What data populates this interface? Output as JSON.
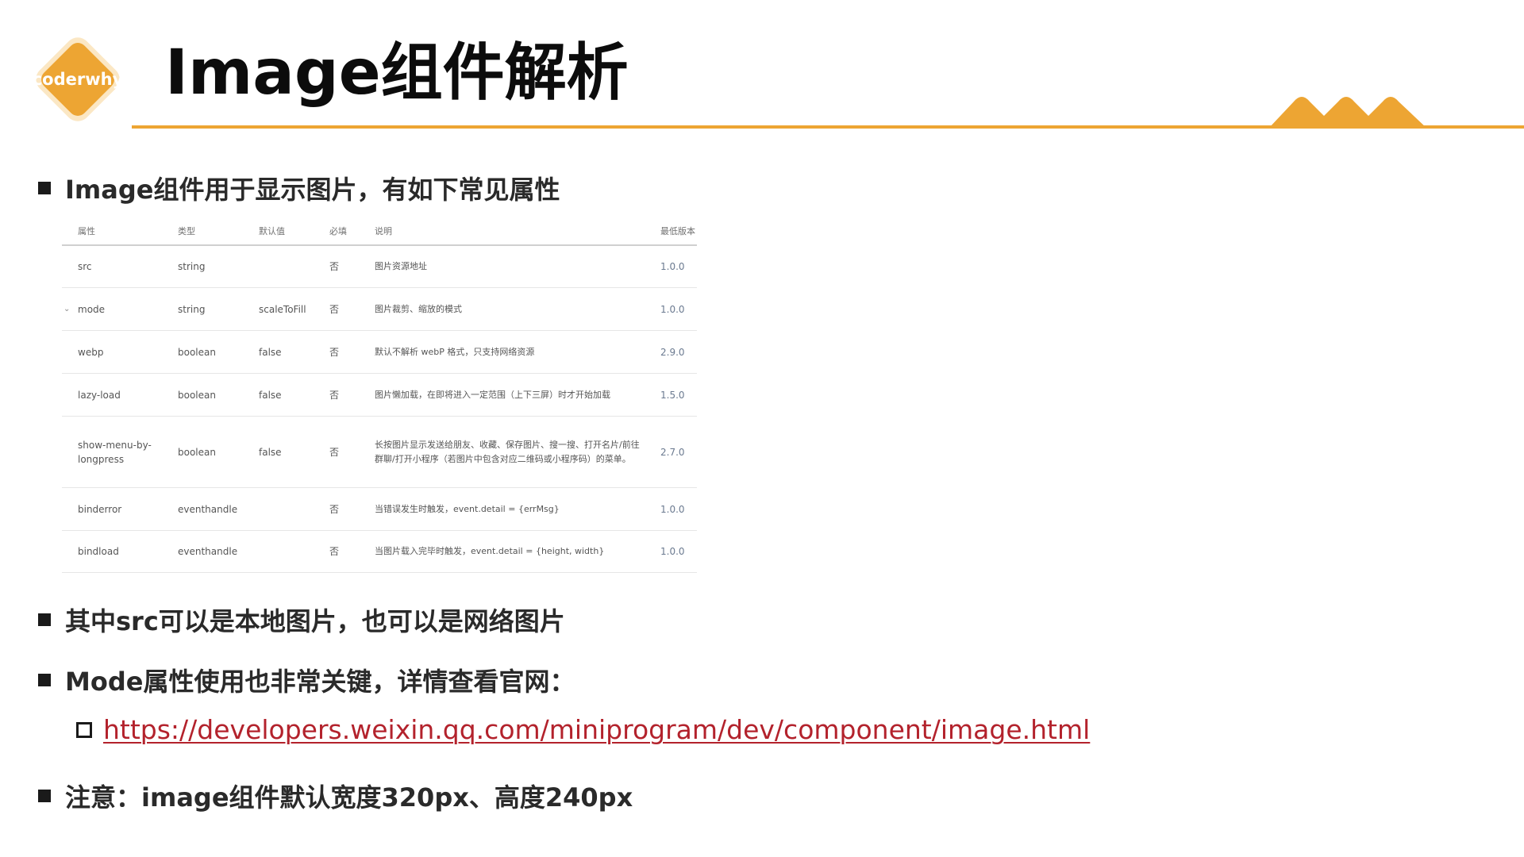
{
  "logo": {
    "text": "coderwhy",
    "color": "#eda533",
    "icon": "diamond-logo-icon"
  },
  "header": {
    "title": "Image组件解析",
    "accent_color": "#eda533",
    "decoration_icon": "mountains-icon"
  },
  "bullets": {
    "b1": "Image组件用于显示图片，有如下常见属性",
    "b2": "其中src可以是本地图片，也可以是网络图片",
    "b3": "Mode属性使用也非常关键，详情查看官网：",
    "b3_link": "https://developers.weixin.qq.com/miniprogram/dev/component/image.html",
    "b4": "注意：image组件默认宽度320px、高度240px"
  },
  "table": {
    "headers": {
      "attr": "属性",
      "type": "类型",
      "default": "默认值",
      "required": "必填",
      "desc": "说明",
      "version": "最低版本"
    },
    "rows": [
      {
        "attr": "src",
        "type": "string",
        "default": "",
        "required": "否",
        "desc": "图片资源地址",
        "version": "1.0.0"
      },
      {
        "attr": "mode",
        "type": "string",
        "default": "scaleToFill",
        "required": "否",
        "desc": "图片裁剪、缩放的模式",
        "version": "1.0.0",
        "expandable": true
      },
      {
        "attr": "webp",
        "type": "boolean",
        "default": "false",
        "required": "否",
        "desc": "默认不解析 webP 格式，只支持网络资源",
        "version": "2.9.0"
      },
      {
        "attr": "lazy-load",
        "type": "boolean",
        "default": "false",
        "required": "否",
        "desc": "图片懒加载，在即将进入一定范围（上下三屏）时才开始加载",
        "version": "1.5.0"
      },
      {
        "attr": "show-menu-by-longpress",
        "type": "boolean",
        "default": "false",
        "required": "否",
        "desc": "长按图片显示发送给朋友、收藏、保存图片、搜一搜、打开名片/前往群聊/打开小程序（若图片中包含对应二维码或小程序码）的菜单。",
        "version": "2.7.0"
      },
      {
        "attr": "binderror",
        "type": "eventhandle",
        "default": "",
        "required": "否",
        "desc": "当错误发生时触发，event.detail = {errMsg}",
        "version": "1.0.0"
      },
      {
        "attr": "bindload",
        "type": "eventhandle",
        "default": "",
        "required": "否",
        "desc": "当图片载入完毕时触发，event.detail = {height, width}",
        "version": "1.0.0"
      }
    ]
  }
}
